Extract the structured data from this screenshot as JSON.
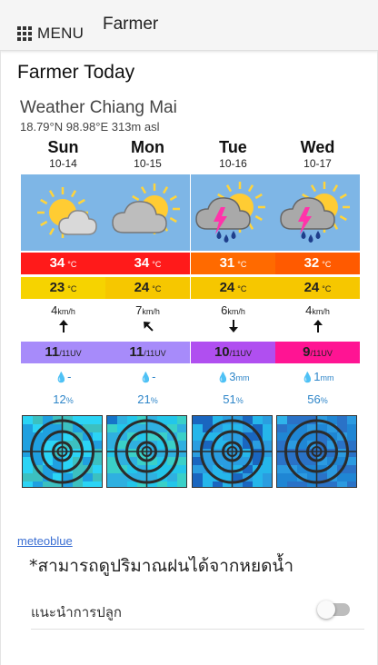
{
  "appbar": {
    "menu_label": "MENU",
    "title": "Farmer",
    "menu_icon": "apps-grid-icon"
  },
  "page": {
    "title": "Farmer Today"
  },
  "widget": {
    "title": "Weather Chiang Mai",
    "coords": "18.79°N 98.98°E 313m asl",
    "temp_unit": "°C",
    "wind_unit": "km/h",
    "uv_max": "/11UV",
    "prob_unit": "%",
    "days": [
      {
        "name": "Sun",
        "date": "10-14",
        "icon": "sun-cloud-icon",
        "tmax": "34",
        "tmax_color": "#ff1a1a",
        "tmin": "23",
        "tmin_color": "#f6d300",
        "wind": "4",
        "wind_dir_deg": 180,
        "uv": "11",
        "uv_color": "#a78bfa",
        "rain": "-",
        "rain_unit": "",
        "prob": "12"
      },
      {
        "name": "Mon",
        "date": "10-15",
        "icon": "sun-cloud-icon",
        "tmax": "34",
        "tmax_color": "#ff1a1a",
        "tmin": "24",
        "tmin_color": "#f6c700",
        "wind": "7",
        "wind_dir_deg": 135,
        "uv": "11",
        "uv_color": "#a78bfa",
        "rain": "-",
        "rain_unit": "",
        "prob": "21"
      },
      {
        "name": "Tue",
        "date": "10-16",
        "icon": "thunderstorm-icon",
        "tmax": "31",
        "tmax_color": "#ff6a00",
        "tmin": "24",
        "tmin_color": "#f6c700",
        "wind": "6",
        "wind_dir_deg": 0,
        "uv": "10",
        "uv_color": "#b04ff0",
        "rain": "3",
        "rain_unit": "mm",
        "prob": "51"
      },
      {
        "name": "Wed",
        "date": "10-17",
        "icon": "thunderstorm-icon",
        "tmax": "32",
        "tmax_color": "#ff5a00",
        "tmin": "24",
        "tmin_color": "#f6c700",
        "wind": "4",
        "wind_dir_deg": 180,
        "uv": "9",
        "uv_color": "#ff1493",
        "rain": "1",
        "rain_unit": "mm",
        "prob": "56"
      }
    ]
  },
  "link": {
    "label": "meteoblue"
  },
  "note": {
    "text": "*สามารถดูปริมาณฝนได้จากหยดน้ำ"
  },
  "settings": {
    "planting_label": "แนะนำการปลูก",
    "planting_enabled": false
  },
  "colors": {
    "icon_bg": "#7eb6e6",
    "link": "#3b6fd3",
    "rain": "#2f86c9"
  }
}
